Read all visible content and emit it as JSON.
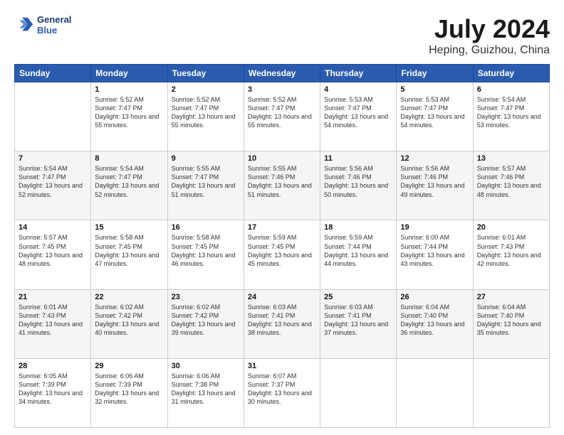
{
  "header": {
    "logo_line1": "General",
    "logo_line2": "Blue",
    "title": "July 2024",
    "location": "Heping, Guizhou, China"
  },
  "weekdays": [
    "Sunday",
    "Monday",
    "Tuesday",
    "Wednesday",
    "Thursday",
    "Friday",
    "Saturday"
  ],
  "weeks": [
    [
      {
        "day": "",
        "sunrise": "",
        "sunset": "",
        "daylight": ""
      },
      {
        "day": "1",
        "sunrise": "Sunrise: 5:52 AM",
        "sunset": "Sunset: 7:47 PM",
        "daylight": "Daylight: 13 hours and 55 minutes."
      },
      {
        "day": "2",
        "sunrise": "Sunrise: 5:52 AM",
        "sunset": "Sunset: 7:47 PM",
        "daylight": "Daylight: 13 hours and 55 minutes."
      },
      {
        "day": "3",
        "sunrise": "Sunrise: 5:52 AM",
        "sunset": "Sunset: 7:47 PM",
        "daylight": "Daylight: 13 hours and 55 minutes."
      },
      {
        "day": "4",
        "sunrise": "Sunrise: 5:53 AM",
        "sunset": "Sunset: 7:47 PM",
        "daylight": "Daylight: 13 hours and 54 minutes."
      },
      {
        "day": "5",
        "sunrise": "Sunrise: 5:53 AM",
        "sunset": "Sunset: 7:47 PM",
        "daylight": "Daylight: 13 hours and 54 minutes."
      },
      {
        "day": "6",
        "sunrise": "Sunrise: 5:54 AM",
        "sunset": "Sunset: 7:47 PM",
        "daylight": "Daylight: 13 hours and 53 minutes."
      }
    ],
    [
      {
        "day": "7",
        "sunrise": "Sunrise: 5:54 AM",
        "sunset": "Sunset: 7:47 PM",
        "daylight": "Daylight: 13 hours and 52 minutes."
      },
      {
        "day": "8",
        "sunrise": "Sunrise: 5:54 AM",
        "sunset": "Sunset: 7:47 PM",
        "daylight": "Daylight: 13 hours and 52 minutes."
      },
      {
        "day": "9",
        "sunrise": "Sunrise: 5:55 AM",
        "sunset": "Sunset: 7:47 PM",
        "daylight": "Daylight: 13 hours and 51 minutes."
      },
      {
        "day": "10",
        "sunrise": "Sunrise: 5:55 AM",
        "sunset": "Sunset: 7:46 PM",
        "daylight": "Daylight: 13 hours and 51 minutes."
      },
      {
        "day": "11",
        "sunrise": "Sunrise: 5:56 AM",
        "sunset": "Sunset: 7:46 PM",
        "daylight": "Daylight: 13 hours and 50 minutes."
      },
      {
        "day": "12",
        "sunrise": "Sunrise: 5:56 AM",
        "sunset": "Sunset: 7:46 PM",
        "daylight": "Daylight: 13 hours and 49 minutes."
      },
      {
        "day": "13",
        "sunrise": "Sunrise: 5:57 AM",
        "sunset": "Sunset: 7:46 PM",
        "daylight": "Daylight: 13 hours and 48 minutes."
      }
    ],
    [
      {
        "day": "14",
        "sunrise": "Sunrise: 5:57 AM",
        "sunset": "Sunset: 7:45 PM",
        "daylight": "Daylight: 13 hours and 48 minutes."
      },
      {
        "day": "15",
        "sunrise": "Sunrise: 5:58 AM",
        "sunset": "Sunset: 7:45 PM",
        "daylight": "Daylight: 13 hours and 47 minutes."
      },
      {
        "day": "16",
        "sunrise": "Sunrise: 5:58 AM",
        "sunset": "Sunset: 7:45 PM",
        "daylight": "Daylight: 13 hours and 46 minutes."
      },
      {
        "day": "17",
        "sunrise": "Sunrise: 5:59 AM",
        "sunset": "Sunset: 7:45 PM",
        "daylight": "Daylight: 13 hours and 45 minutes."
      },
      {
        "day": "18",
        "sunrise": "Sunrise: 5:59 AM",
        "sunset": "Sunset: 7:44 PM",
        "daylight": "Daylight: 13 hours and 44 minutes."
      },
      {
        "day": "19",
        "sunrise": "Sunrise: 6:00 AM",
        "sunset": "Sunset: 7:44 PM",
        "daylight": "Daylight: 13 hours and 43 minutes."
      },
      {
        "day": "20",
        "sunrise": "Sunrise: 6:01 AM",
        "sunset": "Sunset: 7:43 PM",
        "daylight": "Daylight: 13 hours and 42 minutes."
      }
    ],
    [
      {
        "day": "21",
        "sunrise": "Sunrise: 6:01 AM",
        "sunset": "Sunset: 7:43 PM",
        "daylight": "Daylight: 13 hours and 41 minutes."
      },
      {
        "day": "22",
        "sunrise": "Sunrise: 6:02 AM",
        "sunset": "Sunset: 7:42 PM",
        "daylight": "Daylight: 13 hours and 40 minutes."
      },
      {
        "day": "23",
        "sunrise": "Sunrise: 6:02 AM",
        "sunset": "Sunset: 7:42 PM",
        "daylight": "Daylight: 13 hours and 39 minutes."
      },
      {
        "day": "24",
        "sunrise": "Sunrise: 6:03 AM",
        "sunset": "Sunset: 7:41 PM",
        "daylight": "Daylight: 13 hours and 38 minutes."
      },
      {
        "day": "25",
        "sunrise": "Sunrise: 6:03 AM",
        "sunset": "Sunset: 7:41 PM",
        "daylight": "Daylight: 13 hours and 37 minutes."
      },
      {
        "day": "26",
        "sunrise": "Sunrise: 6:04 AM",
        "sunset": "Sunset: 7:40 PM",
        "daylight": "Daylight: 13 hours and 36 minutes."
      },
      {
        "day": "27",
        "sunrise": "Sunrise: 6:04 AM",
        "sunset": "Sunset: 7:40 PM",
        "daylight": "Daylight: 13 hours and 35 minutes."
      }
    ],
    [
      {
        "day": "28",
        "sunrise": "Sunrise: 6:05 AM",
        "sunset": "Sunset: 7:39 PM",
        "daylight": "Daylight: 13 hours and 34 minutes."
      },
      {
        "day": "29",
        "sunrise": "Sunrise: 6:06 AM",
        "sunset": "Sunset: 7:39 PM",
        "daylight": "Daylight: 13 hours and 32 minutes."
      },
      {
        "day": "30",
        "sunrise": "Sunrise: 6:06 AM",
        "sunset": "Sunset: 7:38 PM",
        "daylight": "Daylight: 13 hours and 31 minutes."
      },
      {
        "day": "31",
        "sunrise": "Sunrise: 6:07 AM",
        "sunset": "Sunset: 7:37 PM",
        "daylight": "Daylight: 13 hours and 30 minutes."
      },
      {
        "day": "",
        "sunrise": "",
        "sunset": "",
        "daylight": ""
      },
      {
        "day": "",
        "sunrise": "",
        "sunset": "",
        "daylight": ""
      },
      {
        "day": "",
        "sunrise": "",
        "sunset": "",
        "daylight": ""
      }
    ]
  ]
}
